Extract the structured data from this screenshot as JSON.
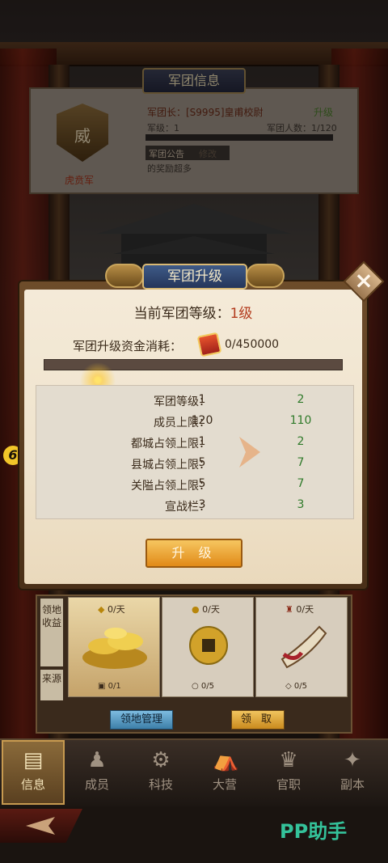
{
  "info_panel": {
    "title": "军团信息",
    "emblem_char": "威",
    "legion_name": "虎贲军",
    "leader_line": "军团长：[S9995]皇甫校尉",
    "upgrade_link": "升级",
    "level_line": "军级：1",
    "members_line": "军团人数：1/120",
    "notice_label": "军团公告",
    "notice_btn": "修改",
    "notice_text": "的奖励超多"
  },
  "modal": {
    "title": "军团升级",
    "current_level_prefix": "当前军团等级：",
    "current_level_value": "1级",
    "cost_label": "军团升级资金消耗：",
    "cost_value": "0/450000",
    "progress": 0.0,
    "stats": [
      {
        "label": "军团等级：",
        "old": "1",
        "new": "2"
      },
      {
        "label": "成员上限：",
        "old": "120",
        "new": "110"
      },
      {
        "label": "都城占领上限：",
        "old": "1",
        "new": "2"
      },
      {
        "label": "县城占领上限：",
        "old": "5",
        "new": "7"
      },
      {
        "label": "关隘占领上限：",
        "old": "5",
        "new": "7"
      },
      {
        "label": "宣战栏：",
        "old": "3",
        "new": "3"
      }
    ],
    "upgrade_button": "升 级"
  },
  "side_badge": "6",
  "rewards": {
    "side_label_1": "领地收益",
    "side_label_2": "来源",
    "cards": [
      {
        "rate": "0/天",
        "count": "0/1",
        "icon": "gold-ingots-icon"
      },
      {
        "rate": "0/天",
        "count": "0/5",
        "icon": "coin-icon"
      },
      {
        "rate": "0/天",
        "count": "0/5",
        "icon": "war-horn-icon"
      }
    ],
    "territory_button": "领地管理",
    "claim_button": "领 取"
  },
  "nav": [
    {
      "label": "信息",
      "icon": "book-icon",
      "active": true
    },
    {
      "label": "成员",
      "icon": "members-icon",
      "active": false
    },
    {
      "label": "科技",
      "icon": "gear-icon",
      "active": false
    },
    {
      "label": "大营",
      "icon": "camp-icon",
      "active": false
    },
    {
      "label": "官职",
      "icon": "official-hat-icon",
      "active": false
    },
    {
      "label": "副本",
      "icon": "dragon-icon",
      "active": false
    }
  ],
  "watermark": "PP助手",
  "colors": {
    "accent_gold": "#e2b84a",
    "stat_new": "#2f7a2a",
    "level_red": "#b33c1e"
  }
}
